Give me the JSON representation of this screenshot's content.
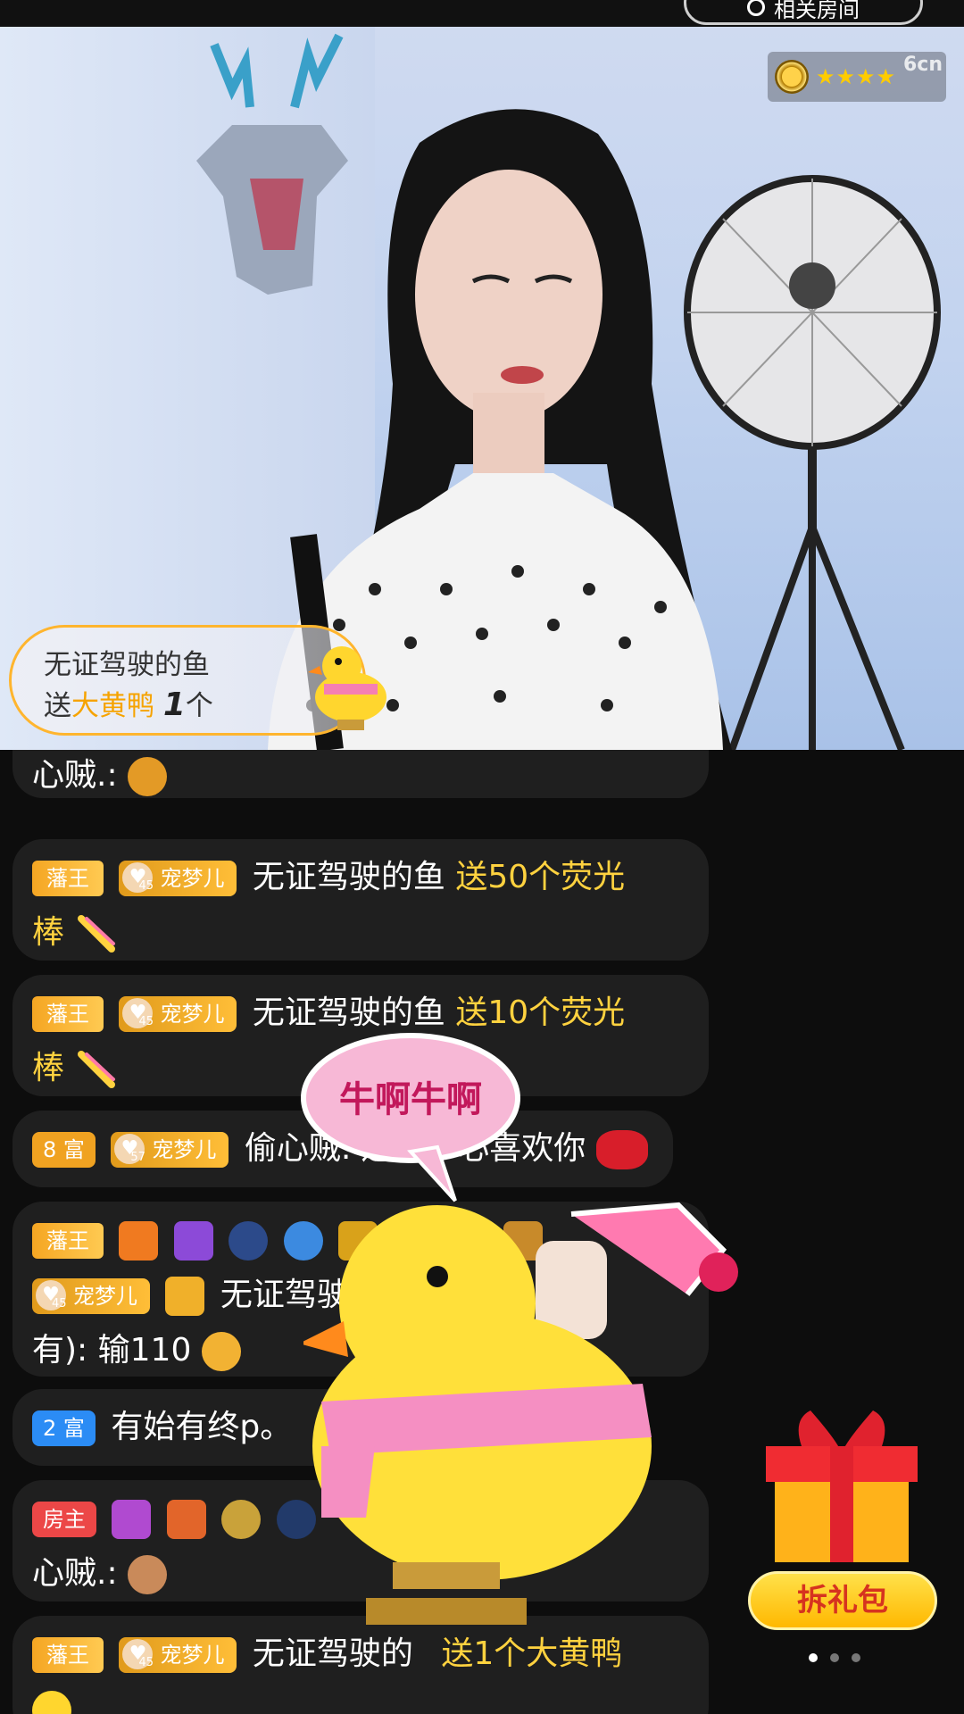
{
  "top_pill": {
    "label": "相关房间"
  },
  "video": {
    "stars": "★★★★",
    "brand": "6cn",
    "gift_banner": {
      "sender": "无证驾驶的鱼",
      "send_word": "送",
      "gift": "大黄鸭",
      "count": "1",
      "unit": "个"
    }
  },
  "chat": {
    "messages": [
      {
        "tail": "心贼.:"
      },
      {
        "king": "藩王",
        "fan": "宠梦儿",
        "fan_level": "45",
        "user": "无证驾驶的鱼",
        "text": "送50个荧光",
        "text2": "棒"
      },
      {
        "king": "藩王",
        "fan": "宠梦儿",
        "fan_level": "45",
        "user": "无证驾驶的鱼",
        "text": "送10个荧光",
        "text2": "棒"
      },
      {
        "rich": "8 富",
        "fan": "宠梦儿",
        "fan_level": "57",
        "user": "偷心贼.",
        "text": "送",
        "text_tail": "心喜欢你"
      },
      {
        "king": "藩王",
        "fan": "宠梦儿",
        "fan_level": "45",
        "user": "无证驾驶的",
        "line3_prefix": "有):",
        "line3": "输110"
      },
      {
        "rich": "2 富",
        "user": "有始有终p。"
      },
      {
        "host": "房主",
        "line2": "心贼.:"
      },
      {
        "king": "藩王",
        "fan": "宠梦儿",
        "fan_level": "45",
        "user": "无证驾驶的",
        "text": "送1个大黄鸭"
      }
    ]
  },
  "overlay": {
    "bubble_text": "牛啊牛啊",
    "unwrap_label": "拆礼包"
  }
}
